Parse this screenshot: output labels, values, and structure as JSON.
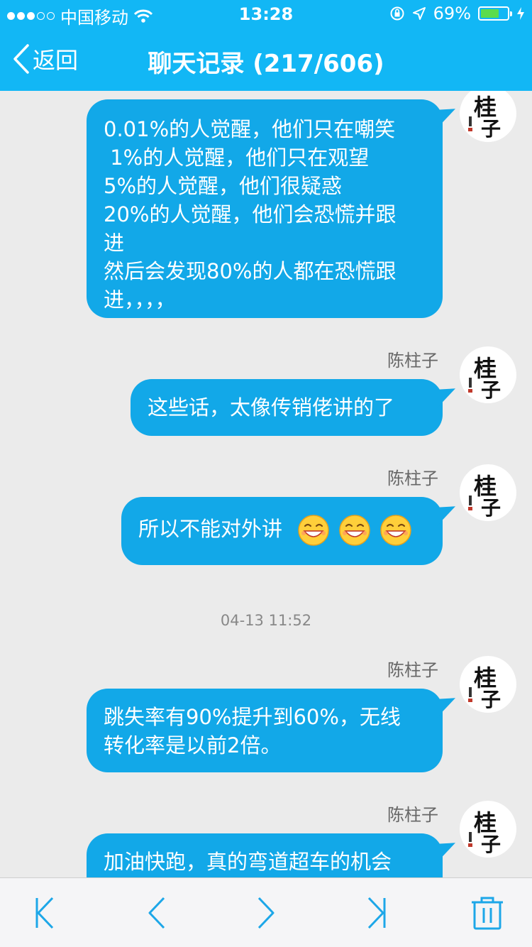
{
  "status_bar": {
    "carrier": "中国移动",
    "time": "13:28",
    "battery_percent": "69%",
    "battery_level": 0.69,
    "icons": [
      "signal-dots",
      "wifi-icon",
      "orientation-lock-icon",
      "location-icon",
      "battery-icon",
      "charging-icon"
    ]
  },
  "nav": {
    "back_label": "返回",
    "title": "聊天记录 (217/606)"
  },
  "messages": [
    {
      "lines": [
        "0.01%的人觉醒，他们只在嘲笑",
        " 1%的人觉醒，他们只在观望",
        "5%的人觉醒，他们很疑惑",
        "20%的人觉醒，他们会恐慌并跟",
        "进",
        "然后会发现80%的人都在恐慌跟",
        "进，，，，"
      ]
    },
    {
      "sender": "陈柱子",
      "lines": [
        "这些话，太像传销佬讲的了"
      ]
    },
    {
      "sender": "陈柱子",
      "lines": [
        "所以不能对外讲"
      ],
      "emoji": [
        "grin-emoji",
        "grin-emoji",
        "grin-emoji"
      ]
    },
    {
      "sender": "陈柱子",
      "lines": [
        "跳失率有90%提升到60%，无线",
        "转化率是以前2倍。"
      ]
    },
    {
      "sender": "陈柱子",
      "lines": [
        "加油快跑，真的弯道超车的机会"
      ]
    }
  ],
  "timestamp": "04-13 11:52",
  "avatar": {
    "glyph_top": "桂",
    "glyph_bottom": "子"
  },
  "toolbar": {
    "buttons": [
      "first-page-icon",
      "previous-page-icon",
      "next-page-icon",
      "last-page-icon",
      "trash-icon"
    ]
  },
  "colors": {
    "accent": "#12b7f5",
    "bubble": "#12a8e8",
    "background": "#ebebeb",
    "toolbar_icon": "#1da7e8"
  }
}
